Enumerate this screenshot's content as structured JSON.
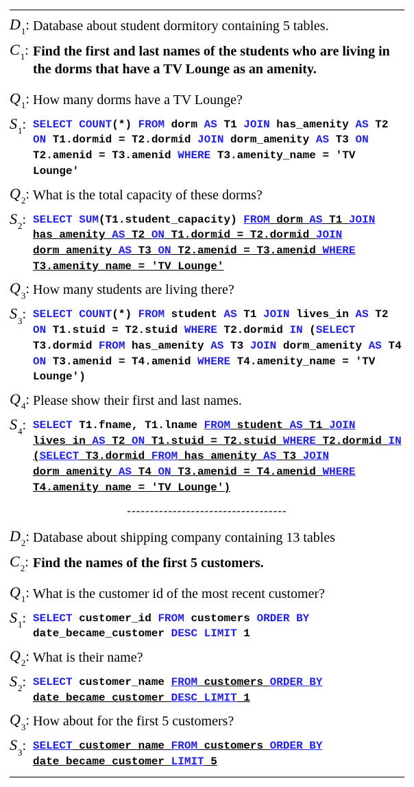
{
  "dashes": "-----------------------------------",
  "block1": {
    "D": {
      "label": "D",
      "sub": "1",
      "text": "Database about student dormitory containing 5 tables."
    },
    "C": {
      "label": "C",
      "sub": "1",
      "text": "Find the first and last names of the students who are living in the dorms that have a TV Lounge as an amenity."
    },
    "Q1": {
      "label": "Q",
      "sub": "1",
      "text": "How many dorms have a TV Lounge?"
    },
    "S1": {
      "label": "S",
      "sub": "1",
      "tokens": [
        [
          "kw",
          "SELECT"
        ],
        [
          "sp",
          " "
        ],
        [
          "kw",
          "COUNT"
        ],
        [
          "id",
          "(*) "
        ],
        [
          "kw",
          "FROM"
        ],
        [
          "id",
          " dorm "
        ],
        [
          "kw",
          "AS"
        ],
        [
          "id",
          " T1 "
        ],
        [
          "kw",
          "JOIN"
        ],
        [
          "id",
          " has_amenity "
        ],
        [
          "kw",
          "AS"
        ],
        [
          "id",
          " T2 "
        ],
        [
          "kw",
          "ON"
        ],
        [
          "id",
          " T1.dormid = T2.dormid "
        ],
        [
          "kw",
          "JOIN"
        ],
        [
          "id",
          " dorm_amenity "
        ],
        [
          "kw",
          "AS"
        ],
        [
          "id",
          " T3 "
        ],
        [
          "kw",
          "ON"
        ],
        [
          "id",
          " T2.amenid = T3.amenid "
        ],
        [
          "kw",
          "WHERE"
        ],
        [
          "id",
          " T3.amenity_name = 'TV Lounge'"
        ]
      ]
    },
    "Q2": {
      "label": "Q",
      "sub": "2",
      "text": "What is the total capacity of these dorms?"
    },
    "S2": {
      "label": "S",
      "sub": "2",
      "tokens": [
        [
          "kw",
          "SELECT"
        ],
        [
          "sp",
          " "
        ],
        [
          "kw",
          "SUM"
        ],
        [
          "id",
          "(T1.student_capacity) "
        ],
        [
          "kwu",
          "FROM"
        ],
        [
          "idu",
          " dorm "
        ],
        [
          "kwu",
          "AS"
        ],
        [
          "idu",
          " T1 "
        ],
        [
          "kwu",
          "JOIN"
        ],
        [
          "idu",
          " has_amenity "
        ],
        [
          "kwu",
          "AS"
        ],
        [
          "idu",
          " T2 "
        ],
        [
          "kwu",
          "ON"
        ],
        [
          "idu",
          " T1.dormid = T2.dormid "
        ],
        [
          "kwu",
          "JOIN"
        ],
        [
          "idu",
          " dorm_amenity "
        ],
        [
          "kwu",
          "AS"
        ],
        [
          "idu",
          " T3 "
        ],
        [
          "kwu",
          "ON"
        ],
        [
          "idu",
          " T2.amenid = T3.amenid "
        ],
        [
          "kwu",
          "WHERE"
        ],
        [
          "idu",
          " T3.amenity_name = 'TV Lounge'"
        ]
      ]
    },
    "Q3": {
      "label": "Q",
      "sub": "3",
      "text": "How many students are living there?"
    },
    "S3": {
      "label": "S",
      "sub": "3",
      "tokens": [
        [
          "kw",
          "SELECT"
        ],
        [
          "sp",
          " "
        ],
        [
          "kw",
          "COUNT"
        ],
        [
          "id",
          "(*) "
        ],
        [
          "kw",
          "FROM"
        ],
        [
          "id",
          " student "
        ],
        [
          "kw",
          "AS"
        ],
        [
          "id",
          " T1 "
        ],
        [
          "kw",
          "JOIN"
        ],
        [
          "id",
          " lives_in "
        ],
        [
          "kw",
          "AS"
        ],
        [
          "id",
          " T2 "
        ],
        [
          "kw",
          "ON"
        ],
        [
          "id",
          " T1.stuid = T2.stuid "
        ],
        [
          "kw",
          "WHERE"
        ],
        [
          "id",
          " T2.dormid "
        ],
        [
          "kw",
          "IN"
        ],
        [
          "id",
          " ("
        ],
        [
          "kw",
          "SELECT"
        ],
        [
          "id",
          " T3.dormid "
        ],
        [
          "kw",
          "FROM"
        ],
        [
          "id",
          " has_amenity "
        ],
        [
          "kw",
          "AS"
        ],
        [
          "id",
          " T3 "
        ],
        [
          "kw",
          "JOIN"
        ],
        [
          "id",
          " dorm_amenity "
        ],
        [
          "kw",
          "AS"
        ],
        [
          "id",
          " T4 "
        ],
        [
          "kw",
          "ON"
        ],
        [
          "id",
          " T3.amenid = T4.amenid "
        ],
        [
          "kw",
          "WHERE"
        ],
        [
          "id",
          " T4.amenity_name = 'TV Lounge')"
        ]
      ]
    },
    "Q4": {
      "label": "Q",
      "sub": "4",
      "text": "Please show their first and last names."
    },
    "S4": {
      "label": "S",
      "sub": "4",
      "tokens": [
        [
          "kw",
          "SELECT"
        ],
        [
          "id",
          " T1.fname, T1.lname "
        ],
        [
          "kwu",
          "FROM"
        ],
        [
          "idu",
          " student "
        ],
        [
          "kwu",
          "AS"
        ],
        [
          "idu",
          " T1 "
        ],
        [
          "kwu",
          "JOIN"
        ],
        [
          "idu",
          " lives_in "
        ],
        [
          "kwu",
          "AS"
        ],
        [
          "idu",
          " T2 "
        ],
        [
          "kwu",
          "ON"
        ],
        [
          "idu",
          " T1.stuid = T2.stuid "
        ],
        [
          "kwu",
          "WHERE"
        ],
        [
          "idu",
          " T2.dormid "
        ],
        [
          "kwu",
          "IN"
        ],
        [
          "idu",
          " ("
        ],
        [
          "kwu",
          "SELECT"
        ],
        [
          "idu",
          " T3.dormid "
        ],
        [
          "kwu",
          "FROM"
        ],
        [
          "idu",
          " has_amenity "
        ],
        [
          "kwu",
          "AS"
        ],
        [
          "idu",
          " T3 "
        ],
        [
          "kwu",
          "JOIN"
        ],
        [
          "idu",
          " dorm_amenity "
        ],
        [
          "kwu",
          "AS"
        ],
        [
          "idu",
          " T4 "
        ],
        [
          "kwu",
          "ON"
        ],
        [
          "idu",
          " T3.amenid = T4.amenid "
        ],
        [
          "kwu",
          "WHERE"
        ],
        [
          "idu",
          " T4.amenity_name = 'TV Lounge')"
        ]
      ]
    }
  },
  "block2": {
    "D": {
      "label": "D",
      "sub": "2",
      "text": "Database about shipping company containing 13 tables"
    },
    "C": {
      "label": "C",
      "sub": "2",
      "text": "Find the names of the first 5 customers."
    },
    "Q1": {
      "label": "Q",
      "sub": "1",
      "text": "What is the customer id of the most recent customer?"
    },
    "S1": {
      "label": "S",
      "sub": "1",
      "tokens": [
        [
          "kw",
          "SELECT"
        ],
        [
          "id",
          " customer_id "
        ],
        [
          "kw",
          "FROM"
        ],
        [
          "id",
          " customers "
        ],
        [
          "kw",
          "ORDER BY"
        ],
        [
          "id",
          " date_became_customer "
        ],
        [
          "kw",
          "DESC"
        ],
        [
          "sp",
          " "
        ],
        [
          "kw",
          "LIMIT"
        ],
        [
          "id",
          " 1"
        ]
      ]
    },
    "Q2": {
      "label": "Q",
      "sub": "2",
      "text": "What is their name?"
    },
    "S2": {
      "label": "S",
      "sub": "2",
      "tokens": [
        [
          "kw",
          "SELECT"
        ],
        [
          "id",
          " customer_name "
        ],
        [
          "kwu",
          "FROM"
        ],
        [
          "idu",
          " customers "
        ],
        [
          "kwu",
          "ORDER BY"
        ],
        [
          "idu",
          " date_became_customer "
        ],
        [
          "kwu",
          "DESC"
        ],
        [
          "idu",
          " "
        ],
        [
          "kwu",
          "LIMIT"
        ],
        [
          "idu",
          " 1"
        ]
      ]
    },
    "Q3": {
      "label": "Q",
      "sub": "3",
      "text": "How about for the first 5 customers?"
    },
    "S3": {
      "label": "S",
      "sub": "3",
      "tokens": [
        [
          "kwu",
          "SELECT"
        ],
        [
          "idu",
          " customer_name "
        ],
        [
          "kwu",
          "FROM"
        ],
        [
          "idu",
          " customers "
        ],
        [
          "kwu",
          "ORDER BY"
        ],
        [
          "idu",
          " date_became_customer "
        ],
        [
          "kwu",
          "LIMIT"
        ],
        [
          "idu",
          " 5"
        ]
      ]
    }
  }
}
